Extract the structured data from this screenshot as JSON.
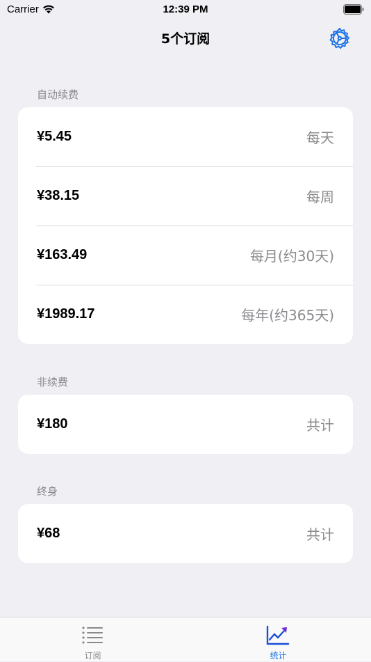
{
  "status_bar": {
    "carrier": "Carrier",
    "time": "12:39 PM"
  },
  "nav": {
    "title": "5个订阅",
    "settings_icon": "gear-icon"
  },
  "sections": [
    {
      "header": "自动续费",
      "rows": [
        {
          "amount": "¥5.45",
          "period": "每天"
        },
        {
          "amount": "¥38.15",
          "period": "每周"
        },
        {
          "amount": "¥163.49",
          "period": "每月(约30天)"
        },
        {
          "amount": "¥1989.17",
          "period": "每年(约365天)"
        }
      ]
    },
    {
      "header": "非续费",
      "rows": [
        {
          "amount": "¥180",
          "period": "共计"
        }
      ]
    },
    {
      "header": "终身",
      "rows": [
        {
          "amount": "¥68",
          "period": "共计"
        }
      ]
    }
  ],
  "tab_bar": {
    "tabs": [
      {
        "label": "订阅",
        "icon": "list-icon",
        "selected": false
      },
      {
        "label": "统计",
        "icon": "chart-icon",
        "selected": true
      }
    ]
  },
  "colors": {
    "accent": "#1a72e8",
    "inactive": "#8a8a8e",
    "background": "#efeff4"
  }
}
